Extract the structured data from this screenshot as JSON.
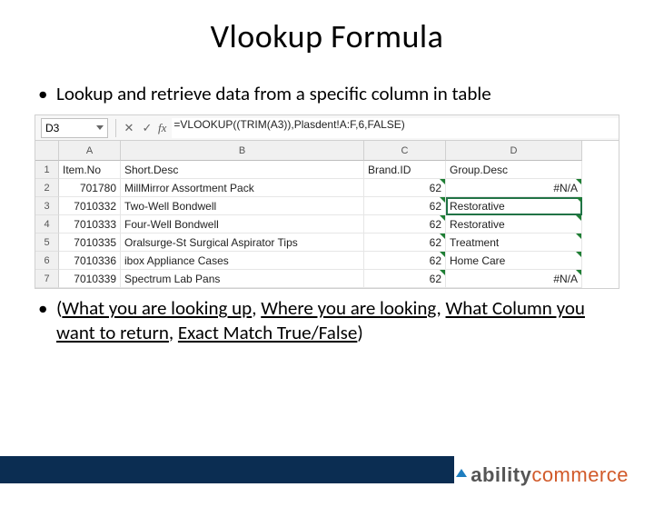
{
  "title": "Vlookup Formula",
  "bullet1": "Lookup and retrieve data from a specific column in table",
  "explain": {
    "open": "(",
    "p1": "What you are looking up",
    "c1": ", ",
    "p2": "Where you are looking",
    "c2": ", ",
    "p3": "What Column you want to return",
    "c3": ", ",
    "p4": "Exact Match True/False",
    "close": ")"
  },
  "excel": {
    "namebox": "D3",
    "formula": "=VLOOKUP((TRIM(A3)),Plasdent!A:F,6,FALSE)",
    "cancel": "✕",
    "accept": "✓",
    "fx": "fx",
    "cols": [
      "A",
      "B",
      "C",
      "D"
    ],
    "rowNums": [
      "1",
      "2",
      "3",
      "4",
      "5",
      "6",
      "7"
    ],
    "header": {
      "A": "Item.No",
      "B": "Short.Desc",
      "C": "Brand.ID",
      "D": "Group.Desc"
    },
    "rows": [
      {
        "A": "701780",
        "B": "MillMirror Assortment Pack",
        "C": "62",
        "D": "#N/A"
      },
      {
        "A": "7010332",
        "B": "Two-Well Bondwell",
        "C": "62",
        "D": "Restorative"
      },
      {
        "A": "7010333",
        "B": "Four-Well Bondwell",
        "C": "62",
        "D": "Restorative"
      },
      {
        "A": "7010335",
        "B": "Oralsurge-St Surgical Aspirator Tips",
        "C": "62",
        "D": "Treatment"
      },
      {
        "A": "7010336",
        "B": "ibox Appliance Cases",
        "C": "62",
        "D": "Home Care"
      },
      {
        "A": "7010339",
        "B": "Spectrum Lab Pans",
        "C": "62",
        "D": "#N/A"
      }
    ]
  },
  "logo": {
    "a": "ability",
    "c": "commerce"
  }
}
